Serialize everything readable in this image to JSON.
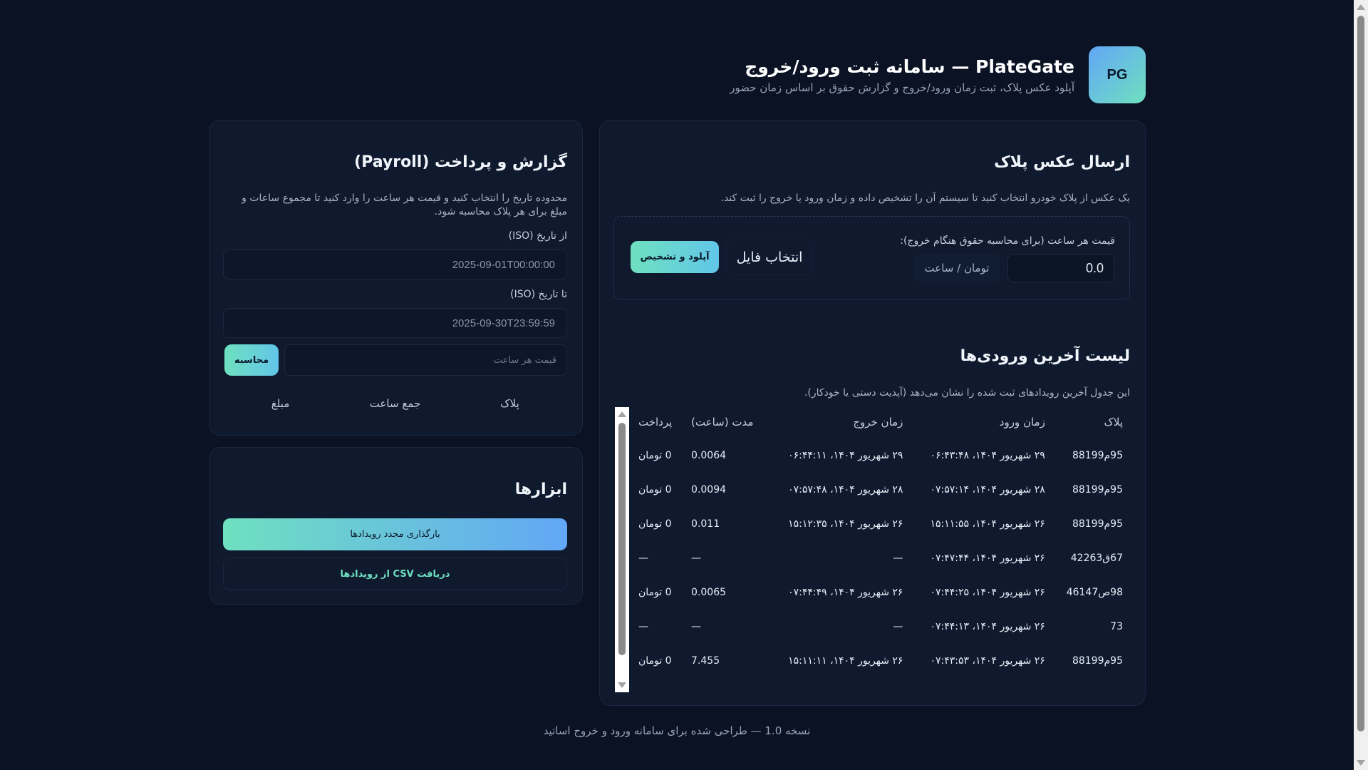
{
  "header": {
    "logo_text": "PG",
    "title": "PlateGate — سامانه ثبت ورود/خروج",
    "subtitle": "آپلود عکس پلاک، ثبت زمان ورود/خروج و گزارش حقوق بر اساس زمان حضور"
  },
  "upload": {
    "title": "ارسال عکس پلاک",
    "description": "یک عکس از پلاک خودرو انتخاب کنید تا سیستم آن را تشخیص داده و زمان ورود یا خروج را ثبت کند.",
    "rate_label": "قیمت هر ساعت (برای محاسبه حقوق هنگام خروج):",
    "rate_value": "0.0",
    "rate_unit": "تومان / ساعت",
    "choose_file_label": "انتخاب فایل",
    "upload_button_label": "آپلود و تشخیص"
  },
  "entries": {
    "title": "لیست آخرین ورودی‌ها",
    "description": "این جدول آخرین رویدادهای ثبت شده را نشان می‌دهد (آپدیت دستی یا خودکار).",
    "columns": [
      "پلاک",
      "زمان ورود",
      "زمان خروج",
      "مدت (ساعت)",
      "پرداخت"
    ],
    "rows": [
      [
        "95م88199",
        "۲۹ شهریور ۱۴۰۴، ۰۶:۴۳:۴۸",
        "۲۹ شهریور ۱۴۰۴، ۰۶:۴۴:۱۱",
        "0.0064",
        "0 تومان"
      ],
      [
        "95م88199",
        "۲۸ شهریور ۱۴۰۴، ۰۷:۵۷:۱۴",
        "۲۸ شهریور ۱۴۰۴، ۰۷:۵۷:۴۸",
        "0.0094",
        "0 تومان"
      ],
      [
        "95م88199",
        "۲۶ شهریور ۱۴۰۴، ۱۵:۱۱:۵۵",
        "۲۶ شهریور ۱۴۰۴، ۱۵:۱۲:۳۵",
        "0.011",
        "0 تومان"
      ],
      [
        "67ق42263",
        "۲۶ شهریور ۱۴۰۴، ۰۷:۴۷:۴۴",
        "—",
        "—",
        "—"
      ],
      [
        "98ص46147",
        "۲۶ شهریور ۱۴۰۴، ۰۷:۴۴:۲۵",
        "۲۶ شهریور ۱۴۰۴، ۰۷:۴۴:۴۹",
        "0.0065",
        "0 تومان"
      ],
      [
        "73",
        "۲۶ شهریور ۱۴۰۴، ۰۷:۴۴:۱۳",
        "—",
        "—",
        "—"
      ],
      [
        "95م88199",
        "۲۶ شهریور ۱۴۰۴، ۰۷:۴۳:۵۳",
        "۲۶ شهریور ۱۴۰۴، ۱۵:۱۱:۱۱",
        "7.455",
        "0 تومان"
      ]
    ]
  },
  "payroll": {
    "title": "گزارش و پرداخت (Payroll)",
    "description": "محدوده تاریخ را انتخاب کنید و قیمت هر ساعت را وارد کنید تا مجموع ساعات و مبلغ برای هر پلاک محاسبه شود.",
    "from_label": "از تاریخ (ISO)",
    "from_value": "2025-09-01T00:00:00",
    "to_label": "تا تاریخ (ISO)",
    "to_value": "2025-09-30T23:59:59",
    "price_placeholder": "قیمت هر ساعت",
    "calc_button_label": "محاسبه",
    "columns": [
      "پلاک",
      "جمع ساعت",
      "مبلغ"
    ]
  },
  "tools": {
    "title": "ابزارها",
    "reload_label": "بارگذاری مجدد رویدادها",
    "csv_label": "دریافت CSV از رویدادها"
  },
  "footer": {
    "text": "نسخه 1.0 — طراحی شده برای سامانه ورود و خروج اساتید"
  }
}
